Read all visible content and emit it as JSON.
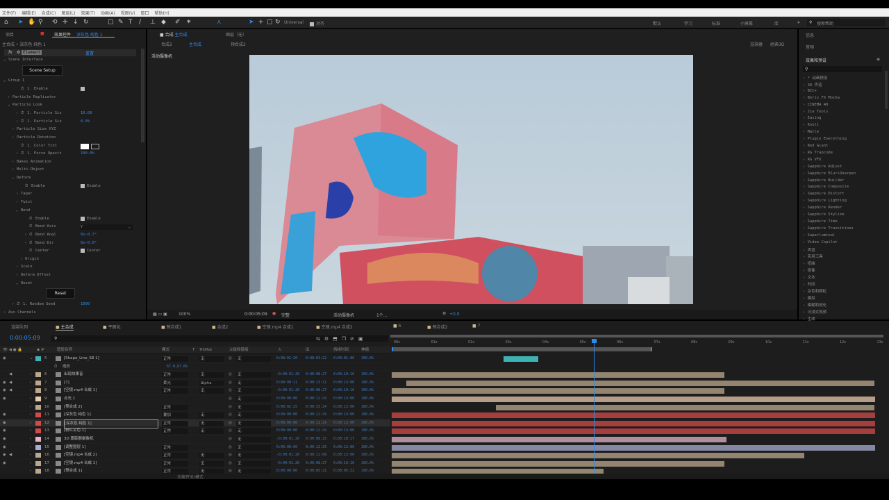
{
  "menu": [
    "文件(F)",
    "编辑(E)",
    "合成(C)",
    "图层(L)",
    "效果(T)",
    "动画(A)",
    "视图(V)",
    "窗口",
    "帮助(H)"
  ],
  "toolbar": {
    "axis_mode": "Universal",
    "snap_label": "对齐",
    "workspaces": [
      "默认",
      "学习",
      "标准",
      "小屏幕",
      "库"
    ],
    "search_placeholder": "搜索帮助"
  },
  "effect_panel": {
    "tab_project": "项目",
    "tab_title": "效果控件",
    "tab_layer": "深灰色 纯色 1",
    "breadcrumb": "主合成 • 深灰色 纯色 1",
    "effect_name": "Element",
    "effect_reset": "重置",
    "rows": [
      {
        "label": "Scene Interface",
        "indent": 2,
        "arrow": "v"
      },
      {
        "label": "Group 1",
        "indent": 2,
        "arrow": "v"
      },
      {
        "label": "1. Enable",
        "indent": 5,
        "stopwatch": true,
        "check": ""
      },
      {
        "label": "Particle Replicator",
        "indent": 3,
        "arrow": ">"
      },
      {
        "label": "Particle Look",
        "indent": 3,
        "arrow": "v"
      },
      {
        "label": "1. Particle Siz",
        "indent": 5,
        "arrow": ">",
        "stopwatch": true,
        "value": "10.00"
      },
      {
        "label": "1. Particle Siz",
        "indent": 5,
        "arrow": ">",
        "stopwatch": true,
        "value": "0.0%"
      },
      {
        "label": "Particle Size XYZ",
        "indent": 4,
        "arrow": ">"
      },
      {
        "label": "Particle Rotation",
        "indent": 4,
        "arrow": ">"
      },
      {
        "label": "1. Color Tint",
        "indent": 5,
        "stopwatch": true,
        "swatch": true
      },
      {
        "label": "1. Force Opacit",
        "indent": 5,
        "arrow": ">",
        "stopwatch": true,
        "value": "100.0%"
      },
      {
        "label": "Bakes Animation",
        "indent": 4,
        "arrow": ">"
      },
      {
        "label": "Multi-Object",
        "indent": 4,
        "arrow": ">"
      },
      {
        "label": "Deform",
        "indent": 4,
        "arrow": "v"
      },
      {
        "label": "Enable",
        "indent": 6,
        "stopwatch": true,
        "check": "Enable"
      },
      {
        "label": "Taper",
        "indent": 5,
        "arrow": ">"
      },
      {
        "label": "Twist",
        "indent": 5,
        "arrow": ">"
      },
      {
        "label": "Bend",
        "indent": 5,
        "arrow": "v"
      },
      {
        "label": "Enable",
        "indent": 7,
        "stopwatch": true,
        "check": "Enable"
      },
      {
        "label": "Bend Axis",
        "indent": 7,
        "stopwatch": true,
        "select": "Y"
      },
      {
        "label": "Bend Angl",
        "indent": 7,
        "arrow": ">",
        "stopwatch": true,
        "value": "0x-0.7°"
      },
      {
        "label": "Bend Dir",
        "indent": 7,
        "arrow": ">",
        "stopwatch": true,
        "value": "0x-0.0°"
      },
      {
        "label": "Center",
        "indent": 7,
        "stopwatch": true,
        "check": "Center"
      },
      {
        "label": "Origin",
        "indent": 6,
        "arrow": ">"
      },
      {
        "label": "Scale",
        "indent": 5,
        "arrow": ">"
      },
      {
        "label": "Deform Offset",
        "indent": 5,
        "arrow": ">"
      },
      {
        "label": "Reset",
        "indent": 5,
        "arrow": "v"
      },
      {
        "label": "1. Random Seed",
        "indent": 4,
        "arrow": ">",
        "stopwatch": true,
        "value": "1000"
      },
      {
        "label": "Aux Channels",
        "indent": 2,
        "arrow": ">"
      }
    ],
    "scene_setup": "Scene Setup",
    "reset_button": "Reset"
  },
  "composition": {
    "tab_title": "合成",
    "comp_name": "主合成",
    "layer_tab": "图层（无）",
    "nav": [
      "合成2",
      "主合成",
      "预合成2"
    ],
    "renderer": "渲染器",
    "renderer_value": "经典3D",
    "camera_label": "活动摄像机",
    "footer": {
      "zoom": "100%",
      "timecode": "0:00:05:09",
      "resolution": "完整",
      "view": "活动摄像机",
      "views": "1个...",
      "exposure": "+0.0"
    }
  },
  "right_panel": {
    "info": "信息",
    "audio": "音频",
    "effects_title": "效果和预设",
    "search_placeholder": "",
    "items": [
      "* 动画预设",
      "3D 声道",
      "BCC+",
      "Boris FX Mocha",
      "CINEMA 4D",
      "Jie Tools",
      "Easing",
      "Knoll",
      "Matte",
      "Plugin Everything",
      "Red Giant",
      "RG Trapcode",
      "RG VFX",
      "Sapphire Adjust",
      "Sapphire Blur+Sharpen",
      "Sapphire Builder",
      "Sapphire Composite",
      "Sapphire Distort",
      "Sapphire Lighting",
      "Sapphire Render",
      "Sapphire Stylize",
      "Sapphire Time",
      "Sapphire Transitions",
      "Superluminal",
      "Video Copilot",
      "声道",
      "实用工具",
      "扭曲",
      "抠像",
      "文本",
      "时间",
      "杂色和颗粒",
      "模拟",
      "模糊和锐化",
      "沉浸式视频",
      "生成"
    ]
  },
  "timeline": {
    "tabs": [
      "渲染队列",
      "主合成",
      "平面化",
      "预合成1",
      "合成2",
      "空镜.mp4 合成1",
      "空镜.mp4 合成2",
      "6",
      "预合成2",
      "7"
    ],
    "active_tab": 1,
    "timecode": "0:00:05:09",
    "headers": {
      "name": "图层名称",
      "mode": "模式",
      "t": "T",
      "trkmat": "TrkMat",
      "parent": "父级和链接",
      "in": "入",
      "out": "出",
      "duration": "持续时间",
      "stretch": "伸缩"
    },
    "ruler": [
      "00s",
      "01s",
      "02s",
      "03s",
      "04s",
      "05s",
      "06s",
      "07s",
      "08s",
      "09s",
      "10s",
      "11s",
      "12s",
      "13s"
    ],
    "playhead_sec": 5.38,
    "work_area_end_sec": 7.0,
    "footer_label": "切换开关/模式",
    "sub_row": {
      "label": "缩放",
      "value": "67.0,67.0%"
    },
    "layers": [
      {
        "num": "5",
        "name": "[Shape_Line_S8 1]",
        "color": "#3fb3b3",
        "mode": "正常",
        "trkmat": "无",
        "parent": "无",
        "in": "0:00:02:20",
        "out": "0:00:03:22",
        "dur": "0:00:01:06",
        "stretch": "100.0%",
        "eye": true,
        "audio": false,
        "bar": [
          3.0,
          3.95
        ],
        "selected": false
      },
      {
        "num": "6",
        "name": "出现效果音",
        "color": "#bba88c",
        "mode": "正常",
        "trkmat": "无",
        "parent": "无",
        "in": "-0:00:01:20",
        "out": "0:00:08:27",
        "dur": "0:00:10:16",
        "stretch": "100.0%",
        "eye": false,
        "audio": true,
        "bar": [
          0,
          8.95
        ]
      },
      {
        "num": "7",
        "name": "[7]",
        "color": "#bba88c",
        "mode": "柔光",
        "trkmat": "Alpha",
        "parent": "无",
        "in": "0:00:00:11",
        "out": "0:00:13:11",
        "dur": "0:00:13:00",
        "stretch": "100.0%",
        "eye": true,
        "audio": true,
        "bar": [
          0.4,
          13
        ]
      },
      {
        "num": "8",
        "name": "[空镜.mp4 合成 1]",
        "color": "#bba88c",
        "mode": "正常",
        "trkmat": "无",
        "parent": "无",
        "in": "-0:00:01:20",
        "out": "0:00:08:27",
        "dur": "0:00:10:16",
        "stretch": "100.0%",
        "eye": true,
        "audio": true,
        "bar": [
          0,
          8.95
        ]
      },
      {
        "num": "9",
        "name": "点光 1",
        "color": "#e8caa8",
        "mode": "",
        "trkmat": "",
        "parent": "无",
        "in": "0:00:00:00",
        "out": "0:00:12:29",
        "dur": "0:00:13:00",
        "stretch": "100.0%",
        "eye": true,
        "audio": false,
        "bar": [
          0,
          13
        ]
      },
      {
        "num": "10",
        "name": "[预合成 2]",
        "color": "#bba88c",
        "mode": "正常",
        "trkmat": "",
        "parent": "无",
        "in": "0:00:02:25",
        "out": "0:00:15:24",
        "dur": "0:00:13:00",
        "stretch": "100.0%",
        "eye": false,
        "audio": false,
        "bar": [
          2.8,
          13
        ]
      },
      {
        "num": "11",
        "name": "[深灰色 纯色 1]",
        "color": "#d44a4a",
        "mode": "叠加",
        "trkmat": "无",
        "parent": "无",
        "in": "0:00:00:00",
        "out": "0:00:12:29",
        "dur": "0:00:13:00",
        "stretch": "100.0%",
        "eye": true,
        "audio": false,
        "bar": [
          0,
          13
        ]
      },
      {
        "num": "12",
        "name": "[深灰色 纯色 1]",
        "color": "#d44a4a",
        "mode": "正常",
        "trkmat": "无",
        "parent": "无",
        "in": "0:00:00:00",
        "out": "0:00:12:29",
        "dur": "0:00:13:00",
        "stretch": "100.0%",
        "eye": true,
        "audio": false,
        "bar": [
          0,
          13
        ],
        "selected": true
      },
      {
        "num": "13",
        "name": "[粉红实色 1]",
        "color": "#d44a4a",
        "mode": "正常",
        "trkmat": "无",
        "parent": "无",
        "in": "0:00:00:00",
        "out": "0:00:12:29",
        "dur": "0:00:13:00",
        "stretch": "100.0%",
        "eye": true,
        "audio": false,
        "bar": [
          0,
          13
        ]
      },
      {
        "num": "14",
        "name": "3D 跟踪器摄像机",
        "color": "#e3b4c8",
        "mode": "",
        "trkmat": "",
        "parent": "无",
        "in": "-0:00:01:20",
        "out": "0:00:08:25",
        "dur": "0:00:10:17",
        "stretch": "100.0%",
        "eye": true,
        "audio": false,
        "bar": [
          0,
          9.0
        ]
      },
      {
        "num": "15",
        "name": "[调整图层 1]",
        "color": "#a8acd0",
        "mode": "正常",
        "trkmat": "",
        "parent": "无",
        "in": "0:00:00:00",
        "out": "0:00:12:29",
        "dur": "0:00:13:00",
        "stretch": "100.0%",
        "eye": true,
        "audio": false,
        "bar": [
          0,
          13
        ]
      },
      {
        "num": "16",
        "name": "[空镜.mp4 合成 2]",
        "color": "#bba88c",
        "mode": "正常",
        "trkmat": "无",
        "parent": "无",
        "in": "-0:00:01:20",
        "out": "0:00:11:09",
        "dur": "0:00:13:00",
        "stretch": "100.0%",
        "eye": true,
        "audio": true,
        "bar": [
          0,
          11.1
        ]
      },
      {
        "num": "17",
        "name": "[空镜.mp4 合成 1]",
        "color": "#bba88c",
        "mode": "正常",
        "trkmat": "无",
        "parent": "无",
        "in": "-0:00:01:20",
        "out": "0:00:08:27",
        "dur": "0:00:10:16",
        "stretch": "100.0%",
        "eye": true,
        "audio": false,
        "bar": [
          0,
          8.95
        ]
      },
      {
        "num": "18",
        "name": "[预合成 1]",
        "color": "#bba88c",
        "mode": "正常",
        "trkmat": "无",
        "parent": "无",
        "in": "0:00:00:00",
        "out": "0:00:05:21",
        "dur": "0:00:05:22",
        "stretch": "100.0%",
        "eye": false,
        "audio": false,
        "bar": [
          0,
          5.7
        ]
      }
    ]
  },
  "colors": {
    "accent": "#2d8ceb",
    "panel": "#1d1d1d",
    "timecode": "#3d7fc8"
  }
}
